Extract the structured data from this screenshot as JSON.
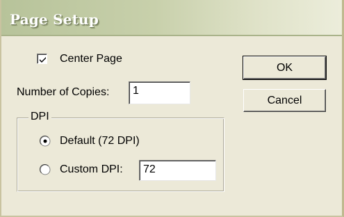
{
  "window": {
    "title": "Page Setup"
  },
  "options": {
    "center_page_label": "Center Page",
    "center_page_checked": true,
    "copies_label": "Number of Copies:",
    "copies_value": "1"
  },
  "dpi_group": {
    "legend": "DPI",
    "default_label": "Default (72 DPI)",
    "default_selected": true,
    "custom_label": "Custom DPI:",
    "custom_selected": false,
    "custom_value": "72"
  },
  "buttons": {
    "ok_label": "OK",
    "cancel_label": "Cancel"
  },
  "icons": {
    "checkbox": "checkmark-icon",
    "radio_selected": "radio-selected-icon",
    "radio_unselected": "radio-unselected-icon"
  },
  "colors": {
    "dialog_background": "#ece9d8",
    "titlebar_start": "#b7c39a",
    "titlebar_end": "#eceddb",
    "title_text": "#ffffff"
  }
}
